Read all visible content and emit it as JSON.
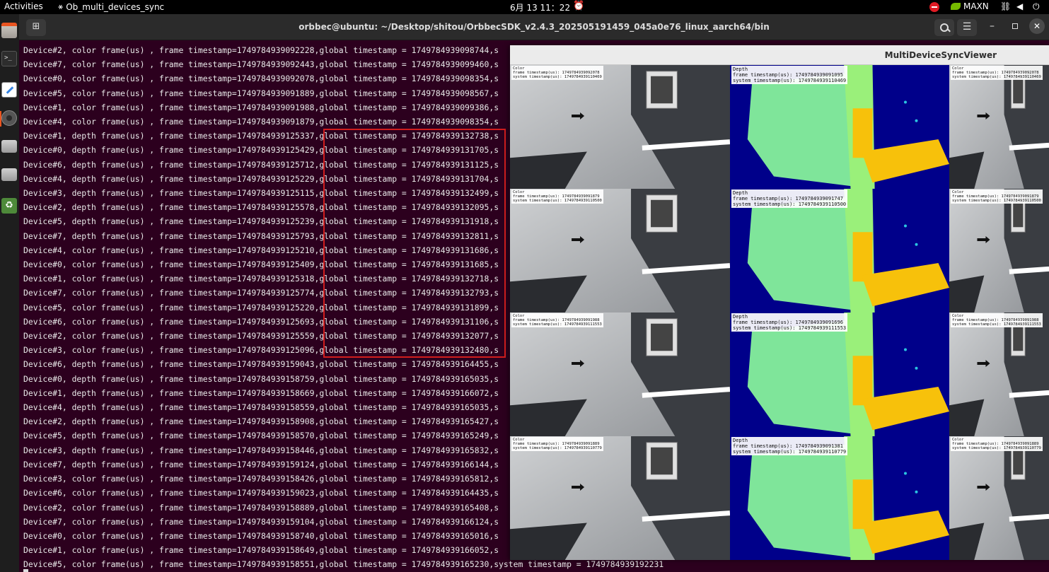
{
  "topbar": {
    "activities": "Activities",
    "app_name": "Ob_multi_devices_sync",
    "clock": "6月 13 11：22",
    "gpu_label": "MAXN"
  },
  "terminal": {
    "title": "orbbec@ubuntu: ~/Desktop/shitou/OrbbecSDK_v2.4.3_202505191459_045a0e76_linux_aarch64/bin"
  },
  "log_lines": [
    "Device#2, color frame(us) , frame timestamp=1749784939092228,global timestamp = 1749784939098744,s",
    "Device#7, color frame(us) , frame timestamp=1749784939092443,global timestamp = 1749784939099460,s",
    "Device#0, color frame(us) , frame timestamp=1749784939092078,global timestamp = 1749784939098354,s",
    "Device#5, color frame(us) , frame timestamp=1749784939091889,global timestamp = 1749784939098567,s",
    "Device#1, color frame(us) , frame timestamp=1749784939091988,global timestamp = 1749784939099386,s",
    "Device#4, color frame(us) , frame timestamp=1749784939091879,global timestamp = 1749784939098354,s",
    "Device#1, depth frame(us) , frame timestamp=1749784939125337,global timestamp = 1749784939132738,s",
    "Device#0, depth frame(us) , frame timestamp=1749784939125429,global timestamp = 1749784939131705,s",
    "Device#6, depth frame(us) , frame timestamp=1749784939125712,global timestamp = 1749784939131125,s",
    "Device#4, depth frame(us) , frame timestamp=1749784939125229,global timestamp = 1749784939131704,s",
    "Device#3, depth frame(us) , frame timestamp=1749784939125115,global timestamp = 1749784939132499,s",
    "Device#2, depth frame(us) , frame timestamp=1749784939125578,global timestamp = 1749784939132095,s",
    "Device#5, depth frame(us) , frame timestamp=1749784939125239,global timestamp = 1749784939131918,s",
    "Device#7, depth frame(us) , frame timestamp=1749784939125793,global timestamp = 1749784939132811,s",
    "Device#4, color frame(us) , frame timestamp=1749784939125210,global timestamp = 1749784939131686,s",
    "Device#0, color frame(us) , frame timestamp=1749784939125409,global timestamp = 1749784939131685,s",
    "Device#1, color frame(us) , frame timestamp=1749784939125318,global timestamp = 1749784939132718,s",
    "Device#7, color frame(us) , frame timestamp=1749784939125774,global timestamp = 1749784939132793,s",
    "Device#5, color frame(us) , frame timestamp=1749784939125220,global timestamp = 1749784939131899,s",
    "Device#6, color frame(us) , frame timestamp=1749784939125693,global timestamp = 1749784939131106,s",
    "Device#2, color frame(us) , frame timestamp=1749784939125559,global timestamp = 1749784939132077,s",
    "Device#3, color frame(us) , frame timestamp=1749784939125096,global timestamp = 1749784939132480,s",
    "Device#6, depth frame(us) , frame timestamp=1749784939159043,global timestamp = 1749784939164455,s",
    "Device#0, depth frame(us) , frame timestamp=1749784939158759,global timestamp = 1749784939165035,s",
    "Device#1, depth frame(us) , frame timestamp=1749784939158669,global timestamp = 1749784939166072,s",
    "Device#4, depth frame(us) , frame timestamp=1749784939158559,global timestamp = 1749784939165035,s",
    "Device#2, depth frame(us) , frame timestamp=1749784939158908,global timestamp = 1749784939165427,s",
    "Device#5, depth frame(us) , frame timestamp=1749784939158570,global timestamp = 1749784939165249,s",
    "Device#3, depth frame(us) , frame timestamp=1749784939158446,global timestamp = 1749784939165832,s",
    "Device#7, depth frame(us) , frame timestamp=1749784939159124,global timestamp = 1749784939166144,s",
    "Device#3, color frame(us) , frame timestamp=1749784939158426,global timestamp = 1749784939165812,s",
    "Device#6, color frame(us) , frame timestamp=1749784939159023,global timestamp = 1749784939164435,s",
    "Device#2, color frame(us) , frame timestamp=1749784939158889,global timestamp = 1749784939165408,s",
    "Device#7, color frame(us) , frame timestamp=1749784939159104,global timestamp = 1749784939166124,s",
    "Device#0, color frame(us) , frame timestamp=1749784939158740,global timestamp = 1749784939165016,s",
    "Device#1, color frame(us) , frame timestamp=1749784939158649,global timestamp = 1749784939166052,s",
    "Device#5, color frame(us) , frame timestamp=1749784939158551,global timestamp = 1749784939165230,system timestamp = 1749784939192231"
  ],
  "viewer": {
    "title": "MultiDeviceSyncViewer",
    "depth_overlays": [
      {
        "line1": "Depth",
        "line2": "frame timestamp(us): 1749784939091095",
        "line3": "system timestamp(us): 1749784939110469"
      },
      {
        "line1": "Depth",
        "line2": "frame timestamp(us): 1749784939091747",
        "line3": "system timestamp(us): 1749784939110500"
      },
      {
        "line1": "Depth",
        "line2": "frame timestamp(us): 1749784939091696",
        "line3": "system timestamp(us): 1749784939111553"
      },
      {
        "line1": "Depth",
        "line2": "frame timestamp(us): 1749784939091381",
        "line3": "system timestamp(us): 1749784939110779"
      }
    ],
    "color_overlays": [
      {
        "line1": "Color",
        "line2": "frame timestamp(us): 1749784939092078",
        "line3": "system timestamp(us): 1749784939110469"
      },
      {
        "line1": "Color",
        "line2": "frame timestamp(us): 1749784939091879",
        "line3": "system timestamp(us): 1749784939110500"
      },
      {
        "line1": "Color",
        "line2": "frame timestamp(us): 1749784939091988",
        "line3": "system timestamp(us): 1749784939111553"
      },
      {
        "line1": "Color",
        "line2": "frame timestamp(us): 1749784939091889",
        "line3": "system timestamp(us): 1749784939110779"
      }
    ]
  },
  "colors": {
    "terminal_bg": "#2c001e",
    "highlight": "#d01d1d",
    "depth_blue": "#00008a",
    "depth_green": "#7fe59a",
    "depth_yellow": "#f7c10b"
  }
}
